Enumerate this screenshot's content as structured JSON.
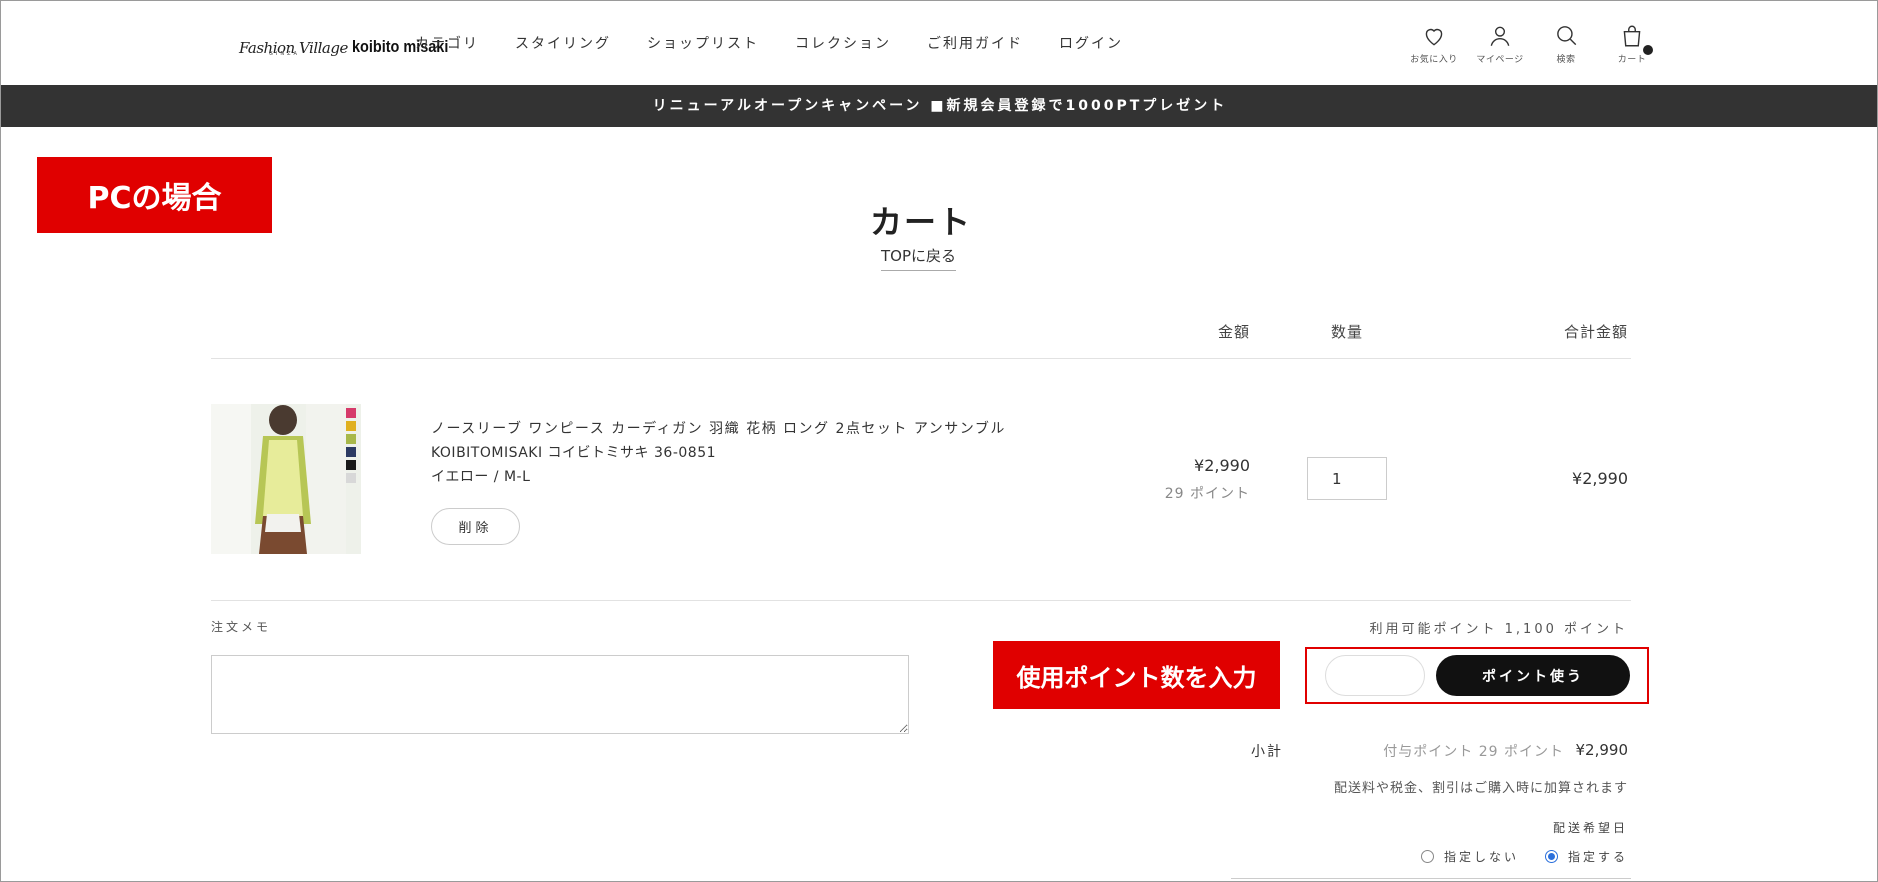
{
  "header": {
    "logo_script": "Fashion Village",
    "logo_sub": "GINZA",
    "logo_name": "koibito misaki",
    "nav": [
      "カテゴリ",
      "スタイリング",
      "ショップリスト",
      "コレクション",
      "ご利用ガイド",
      "ログイン"
    ],
    "icons": [
      {
        "icon": "heart-icon",
        "label": "お気に入り"
      },
      {
        "icon": "user-icon",
        "label": "マイページ"
      },
      {
        "icon": "search-icon",
        "label": "検索"
      },
      {
        "icon": "cart-icon",
        "label": "カート"
      }
    ]
  },
  "banner": "リニューアルオープンキャンペーン ■新規会員登録で1000PTプレゼント",
  "annotations": {
    "pc_label": "PCの場合",
    "point_label": "使用ポイント数を入力",
    "accent": "#e00000"
  },
  "page": {
    "title": "カート",
    "back_link": "TOPに戻る"
  },
  "table": {
    "headers": {
      "price": "金額",
      "quantity": "数量",
      "total": "合計金額"
    }
  },
  "item": {
    "name": "ノースリーブ ワンピース カーディガン 羽織 花柄 ロング 2点セット アンサンブル",
    "brand": "KOIBITOMISAKI コイビトミサキ 36-0851",
    "variant": "イエロー / M-L",
    "delete_label": "削除",
    "price": "¥2,990",
    "points": "29 ポイント",
    "quantity": "1",
    "line_total": "¥2,990",
    "swatches": [
      "#d63a6a",
      "#e0b020",
      "#a8b84a",
      "#2c3a62",
      "#1a1a1a",
      "#d8d8d8"
    ]
  },
  "order": {
    "memo_label": "注文メモ",
    "available_points": "利用可能ポイント 1,100 ポイント",
    "use_points_button": "ポイント使う",
    "point_input_placeholder": "",
    "subtotal_label": "小計",
    "granted_points": "付与ポイント 29 ポイント",
    "subtotal": "¥2,990",
    "tax_note": "配送料や税金、割引はご購入時に加算されます",
    "delivery_label": "配送希望日",
    "delivery_options": [
      "指定しない",
      "指定する"
    ],
    "delivery_selected": "指定する"
  }
}
